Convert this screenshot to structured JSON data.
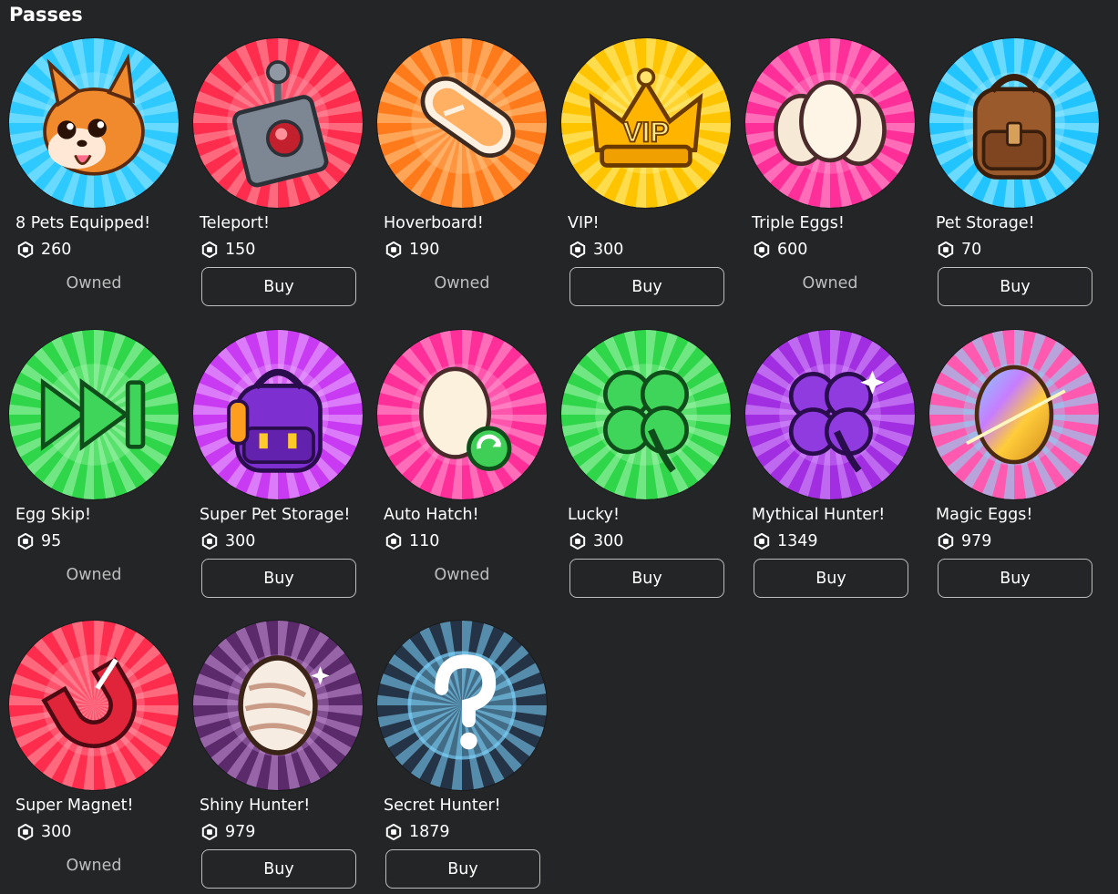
{
  "section_title": "Passes",
  "labels": {
    "owned": "Owned",
    "buy": "Buy"
  },
  "currency_icon": "robux-icon",
  "passes": [
    {
      "name": "8 Pets Equipped!",
      "price": "260",
      "status": "Owned",
      "icon": "corgi-pet-icon",
      "ray_colors": [
        "#2ec9ff",
        "#9be7ff"
      ]
    },
    {
      "name": "Teleport!",
      "price": "150",
      "status": "Buy",
      "icon": "teleport-remote-icon",
      "ray_colors": [
        "#ff2d4d",
        "#ff9aa8"
      ]
    },
    {
      "name": "Hoverboard!",
      "price": "190",
      "status": "Owned",
      "icon": "hoverboard-icon",
      "ray_colors": [
        "#ff7a1a",
        "#ffc98a"
      ]
    },
    {
      "name": "VIP!",
      "price": "300",
      "status": "Buy",
      "icon": "vip-crown-icon",
      "ray_colors": [
        "#ffc400",
        "#fff08a"
      ]
    },
    {
      "name": "Triple Eggs!",
      "price": "600",
      "status": "Owned",
      "icon": "triple-eggs-icon",
      "ray_colors": [
        "#ff2f9a",
        "#ff9fd0"
      ]
    },
    {
      "name": "Pet Storage!",
      "price": "70",
      "status": "Buy",
      "icon": "backpack-icon",
      "ray_colors": [
        "#22c4ff",
        "#a6ecff"
      ]
    },
    {
      "name": "Egg Skip!",
      "price": "95",
      "status": "Owned",
      "icon": "fast-forward-icon",
      "ray_colors": [
        "#2fd64a",
        "#a8f5b2"
      ]
    },
    {
      "name": "Super Pet Storage!",
      "price": "300",
      "status": "Buy",
      "icon": "purple-backpack-icon",
      "ray_colors": [
        "#c93bf2",
        "#eab0ff"
      ]
    },
    {
      "name": "Auto Hatch!",
      "price": "110",
      "status": "Owned",
      "icon": "auto-hatch-egg-icon",
      "ray_colors": [
        "#ff2f9a",
        "#ff9fd0"
      ]
    },
    {
      "name": "Lucky!",
      "price": "300",
      "status": "Buy",
      "icon": "clover-icon",
      "ray_colors": [
        "#2fd64a",
        "#a8f5b2"
      ]
    },
    {
      "name": "Mythical Hunter!",
      "price": "1349",
      "status": "Buy",
      "icon": "purple-clover-icon",
      "ray_colors": [
        "#a12ee0",
        "#d99bff"
      ]
    },
    {
      "name": "Magic Eggs!",
      "price": "979",
      "status": "Buy",
      "icon": "rainbow-egg-icon",
      "ray_colors": [
        "#ff5ab0",
        "#7fe0ff"
      ]
    },
    {
      "name": "Super Magnet!",
      "price": "300",
      "status": "Owned",
      "icon": "magnet-icon",
      "ray_colors": [
        "#ff2d4d",
        "#ff9aa8"
      ]
    },
    {
      "name": "Shiny Hunter!",
      "price": "979",
      "status": "Buy",
      "icon": "shiny-egg-icon",
      "ray_colors": [
        "#5b2a6b",
        "#c993d9"
      ]
    },
    {
      "name": "Secret Hunter!",
      "price": "1879",
      "status": "Buy",
      "icon": "question-mark-icon",
      "ray_colors": [
        "#243446",
        "#7fd6ff"
      ]
    }
  ]
}
